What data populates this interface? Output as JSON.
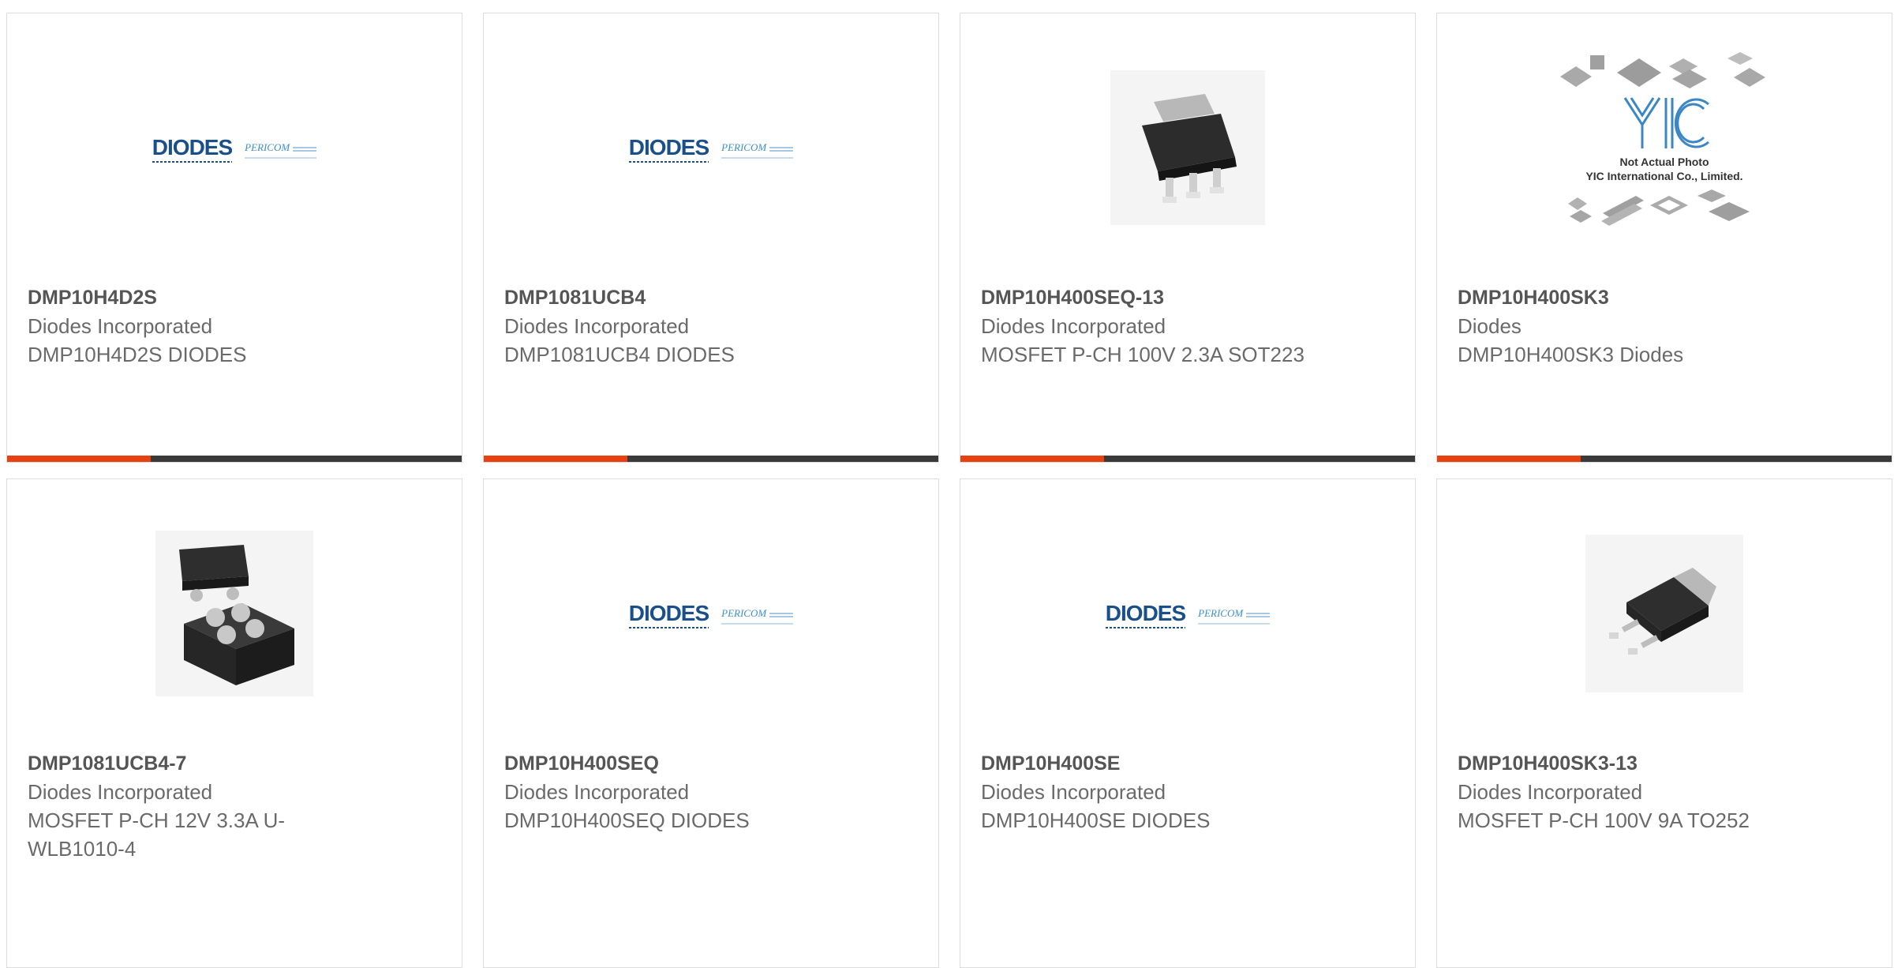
{
  "products": [
    {
      "part_number": "DMP10H4D2S",
      "manufacturer": "Diodes Incorporated",
      "description": "DMP10H4D2S DIODES",
      "image": "diodes-pericom-logo",
      "logo": {
        "main": "DIODES",
        "secondary": "PERICOM"
      }
    },
    {
      "part_number": "DMP1081UCB4",
      "manufacturer": "Diodes Incorporated",
      "description": "DMP1081UCB4 DIODES",
      "image": "diodes-pericom-logo",
      "logo": {
        "main": "DIODES",
        "secondary": "PERICOM"
      }
    },
    {
      "part_number": "DMP10H400SEQ-13",
      "manufacturer": "Diodes Incorporated",
      "description": "MOSFET P-CH 100V 2.3A SOT223",
      "image": "sot223-package-photo"
    },
    {
      "part_number": "DMP10H400SK3",
      "manufacturer": "Diodes",
      "description": "DMP10H400SK3 Diodes",
      "image": "yic-placeholder-photo",
      "placeholder": {
        "line1": "Not Actual Photo",
        "line2": "YIC International Co., Limited."
      }
    },
    {
      "part_number": "DMP1081UCB4-7",
      "manufacturer": "Diodes Incorporated",
      "description": "MOSFET P-CH 12V 3.3A U-WLB1010-4",
      "image": "wlb-package-photo"
    },
    {
      "part_number": "DMP10H400SEQ",
      "manufacturer": "Diodes Incorporated",
      "description": "DMP10H400SEQ DIODES",
      "image": "diodes-pericom-logo",
      "logo": {
        "main": "DIODES",
        "secondary": "PERICOM"
      }
    },
    {
      "part_number": "DMP10H400SE",
      "manufacturer": "Diodes Incorporated",
      "description": "DMP10H400SE DIODES",
      "image": "diodes-pericom-logo",
      "logo": {
        "main": "DIODES",
        "secondary": "PERICOM"
      }
    },
    {
      "part_number": "DMP10H400SK3-13",
      "manufacturer": "Diodes Incorporated",
      "description": "MOSFET P-CH 100V 9A TO252",
      "image": "to252-package-photo"
    }
  ],
  "colors": {
    "accent": "#e8400e",
    "bar": "#3a3a3a",
    "border": "#dcdcdc",
    "title_text": "#555555",
    "body_text": "#6a6a6a",
    "diodes_blue": "#1a4f8a"
  }
}
